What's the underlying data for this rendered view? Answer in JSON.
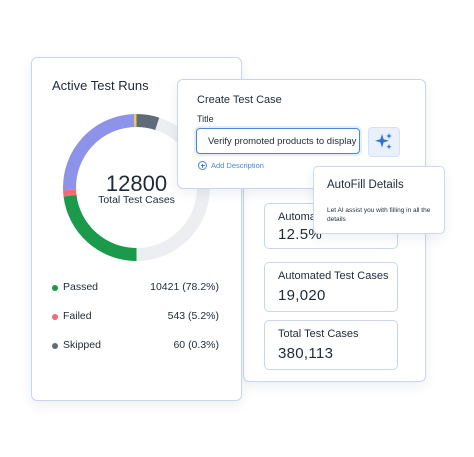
{
  "active_runs": {
    "title": "Active Test Runs",
    "total_value": "12800",
    "total_label": "Total Test Cases",
    "legend": [
      {
        "label": "Passed",
        "value": "10421 (78.2%)",
        "color": "#1a9a4a"
      },
      {
        "label": "Failed",
        "value": "543 (5.2%)",
        "color": "#f06b74"
      },
      {
        "label": "Skipped",
        "value": "60 (0.3%)",
        "color": "#5f6b7a"
      }
    ]
  },
  "create_dialog": {
    "title": "Create Test Case",
    "field_label": "Title",
    "field_value": "Verify promoted products to display",
    "add_description": "Add Description",
    "ai_icon": "sparkles-icon"
  },
  "autofill": {
    "title": "AutoFill Details",
    "description": "Let AI assist you with filling in all the details"
  },
  "stats": [
    {
      "label": "Automa",
      "value": "12.5%"
    },
    {
      "label": "Automated Test Cases",
      "value": "19,020"
    },
    {
      "label": "Total Test Cases",
      "value": "380,113"
    }
  ],
  "colors": {
    "accent": "#4a86d8",
    "passed": "#1a9a4a",
    "failed": "#f06b74",
    "skipped": "#5f6b7a",
    "purple": "#8c93e8",
    "yellow": "#f2c94c",
    "track": "#eceef2"
  }
}
